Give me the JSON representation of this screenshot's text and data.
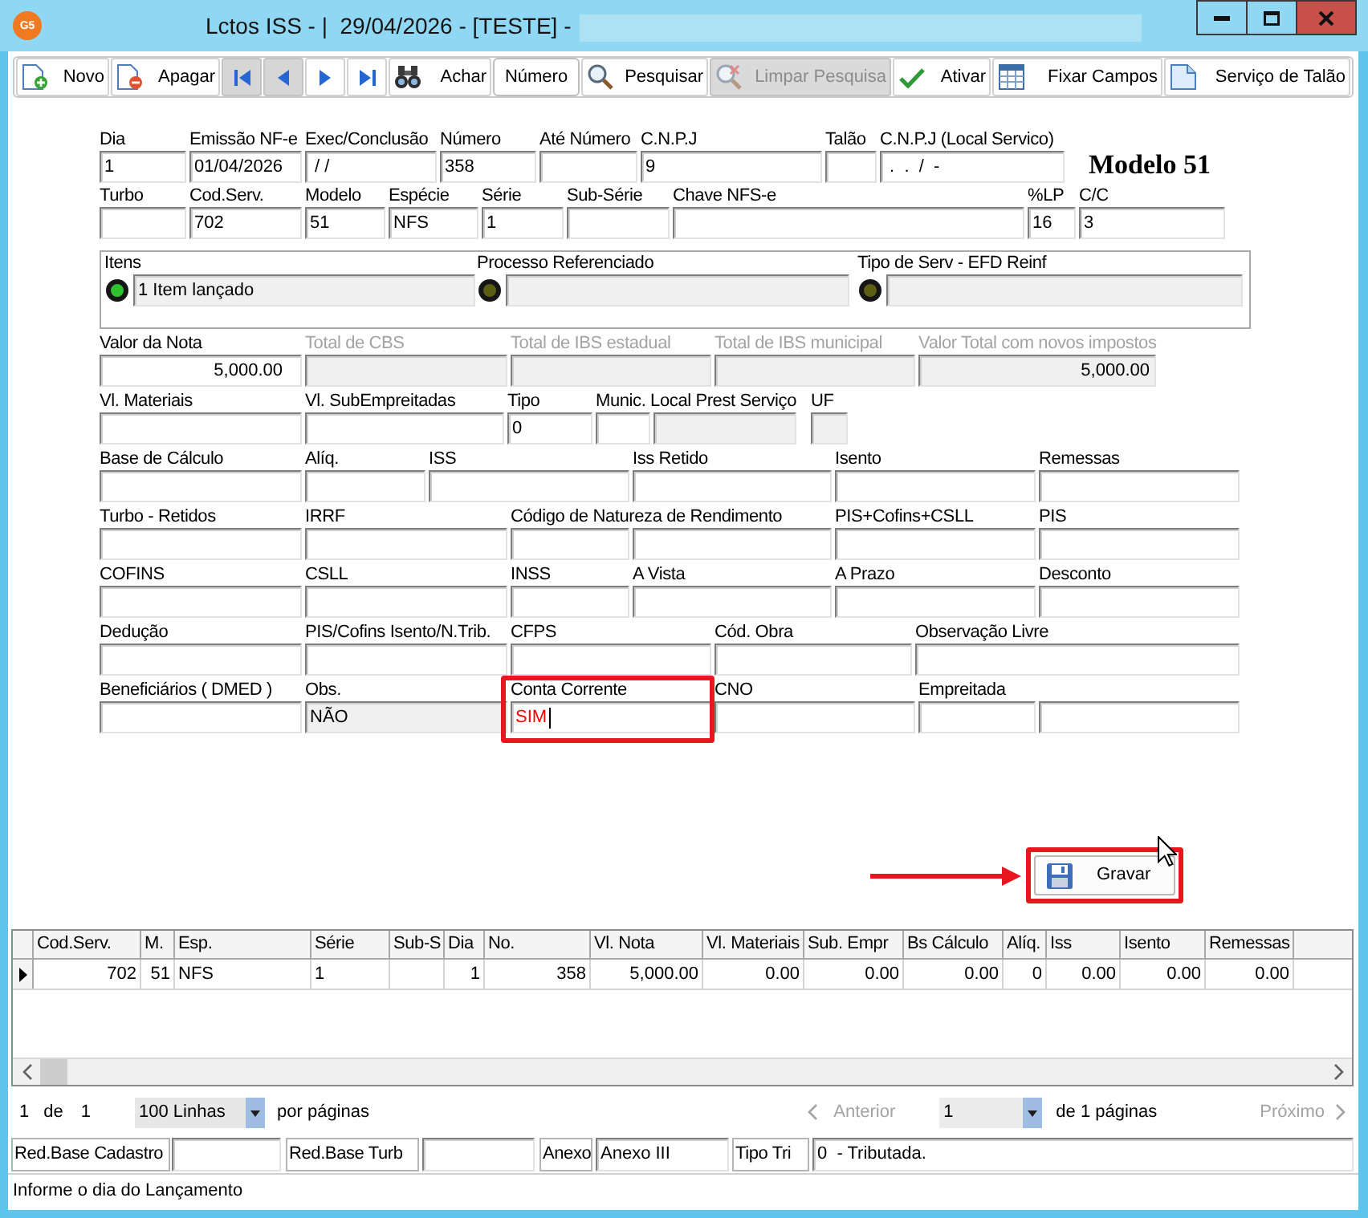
{
  "window": {
    "logo": "G5",
    "title": "Lctos ISS - |  29/04/2026 - [TESTE] -"
  },
  "toolbar": [
    {
      "kind": "button",
      "label": "Novo",
      "disabled": false
    },
    {
      "kind": "button",
      "label": "Apagar",
      "disabled": false
    },
    {
      "kind": "nav",
      "disabled": true
    },
    {
      "kind": "nav",
      "disabled": true
    },
    {
      "kind": "nav",
      "disabled": false
    },
    {
      "kind": "nav",
      "disabled": false
    },
    {
      "kind": "button",
      "label": "Achar",
      "disabled": false
    },
    {
      "kind": "field",
      "label": "Número",
      "disabled": false
    },
    {
      "kind": "button",
      "label": "Pesquisar",
      "disabled": false
    },
    {
      "kind": "button",
      "label": "Limpar Pesquisa",
      "disabled": true
    },
    {
      "kind": "button",
      "label": "Ativar",
      "disabled": false
    },
    {
      "kind": "button",
      "label": "Fixar Campos",
      "disabled": false
    },
    {
      "kind": "button",
      "label": "Serviço de Talão",
      "disabled": false
    }
  ],
  "form": {
    "header_rows": [
      [
        {
          "label": "Dia",
          "value": "1",
          "kind": "input",
          "highlighted": false
        },
        {
          "label": "Emissão NF-e",
          "value": "01/04/2026",
          "kind": "input",
          "highlighted": false
        },
        {
          "label": "Exec/Conclusão",
          "value": " / /",
          "kind": "input",
          "highlighted": false
        },
        {
          "label": "Número",
          "value": "358",
          "kind": "input",
          "highlighted": false
        },
        {
          "label": "Até Número",
          "kind": "input",
          "highlighted": false
        },
        {
          "label": "C.N.P.J",
          "value": "9",
          "kind": "input",
          "highlighted": false
        },
        {
          "label": "Talão",
          "kind": "input",
          "highlighted": false
        },
        {
          "label": "C.N.P.J (Local Servico)",
          "value": " .  .  /  -",
          "kind": "input",
          "highlighted": false
        }
      ],
      [
        {
          "label": "Turbo",
          "kind": "input",
          "highlighted": false
        },
        {
          "label": "Cod.Serv.",
          "value": "702",
          "kind": "input",
          "highlighted": false
        },
        {
          "label": "Modelo",
          "value": "51",
          "kind": "input",
          "highlighted": false
        },
        {
          "label": "Espécie",
          "value": "NFS",
          "kind": "input",
          "highlighted": false
        },
        {
          "label": "Série",
          "value": "1",
          "kind": "input",
          "highlighted": false
        },
        {
          "label": "Sub-Série",
          "kind": "input",
          "highlighted": false
        },
        {
          "label": "Chave NFS-e",
          "kind": "input",
          "highlighted": false
        },
        {
          "label": "%LP",
          "value": "16",
          "kind": "input",
          "highlighted": false
        },
        {
          "label": "C/C",
          "value": "3",
          "kind": "input",
          "highlighted": false
        }
      ]
    ],
    "model_title": "Modelo 51",
    "references": [
      {
        "label": "Itens",
        "value": "1 Item lançado",
        "color": "#2fc22f"
      },
      {
        "label": "Processo Referenciado",
        "color": "#5e5e12"
      },
      {
        "label": "Tipo de Serv - EFD Reinf",
        "color": "#5e5e12"
      }
    ],
    "rows": [
      [
        {
          "label": "Valor da Nota",
          "value": "5,000.00",
          "kind": "input",
          "highlighted": false
        },
        {
          "label": "Total de CBS",
          "kind": "disabled",
          "highlighted": false
        },
        {
          "label": "Total de IBS estadual",
          "kind": "disabled",
          "highlighted": false
        },
        {
          "label": "Total de IBS municipal",
          "kind": "disabled",
          "highlighted": false
        },
        {
          "label": "Valor Total com novos impostos",
          "value": "5,000.00",
          "kind": "disabled",
          "highlighted": false
        }
      ],
      [
        {
          "label": "Vl. Materiais",
          "kind": "input",
          "highlighted": false
        },
        {
          "label": "Vl. SubEmpreitadas",
          "kind": "input",
          "highlighted": false
        },
        {
          "label": "Tipo",
          "value": "0",
          "kind": "input",
          "highlighted": false
        },
        {
          "label": "Munic. Local Prest Serviço",
          "kind": "input",
          "highlighted": false
        },
        {
          "kind": "readonly",
          "highlighted": false
        },
        {
          "label": "UF",
          "kind": "readonly",
          "highlighted": false
        }
      ],
      [
        {
          "label": "Base de Cálculo",
          "kind": "input",
          "highlighted": false
        },
        {
          "label": "Alíq.",
          "kind": "input",
          "highlighted": false
        },
        {
          "label": "ISS",
          "kind": "input",
          "highlighted": false
        },
        {
          "label": "Iss Retido",
          "kind": "input",
          "highlighted": false
        },
        {
          "label": "Isento",
          "kind": "input",
          "highlighted": false
        },
        {
          "label": "Remessas",
          "kind": "input",
          "highlighted": false
        }
      ],
      [
        {
          "label": "Turbo - Retidos",
          "kind": "input",
          "highlighted": false
        },
        {
          "label": "IRRF",
          "kind": "input",
          "highlighted": false
        },
        {
          "label": "Código de Natureza de Rendimento",
          "kind": "input",
          "highlighted": false
        },
        {
          "kind": "input",
          "highlighted": false
        },
        {
          "label": "PIS+Cofins+CSLL",
          "kind": "input",
          "highlighted": false
        },
        {
          "label": "PIS",
          "kind": "input",
          "highlighted": false
        }
      ],
      [
        {
          "label": "COFINS",
          "kind": "input",
          "highlighted": false
        },
        {
          "label": "CSLL",
          "kind": "input",
          "highlighted": false
        },
        {
          "label": "INSS",
          "kind": "input",
          "highlighted": false
        },
        {
          "label": "A Vista",
          "kind": "input",
          "highlighted": false
        },
        {
          "label": "A Prazo",
          "kind": "input",
          "highlighted": false
        },
        {
          "label": "Desconto",
          "kind": "input",
          "highlighted": false
        }
      ],
      [
        {
          "label": "Dedução",
          "kind": "input",
          "highlighted": false
        },
        {
          "label": "PIS/Cofins Isento/N.Trib.",
          "kind": "input",
          "highlighted": false
        },
        {
          "label": "CFPS",
          "kind": "input",
          "highlighted": false
        },
        {
          "label": "Cód. Obra",
          "kind": "input",
          "highlighted": false
        },
        {
          "label": "Observação Livre",
          "kind": "input",
          "highlighted": false
        }
      ],
      [
        {
          "label": "Beneficiários ( DMED )",
          "kind": "input",
          "highlighted": false
        },
        {
          "label": "Obs.",
          "value": "NÃO",
          "kind": "readonly",
          "highlighted": false
        },
        {
          "label": "Conta Corrente",
          "value": "SIM",
          "kind": "focused",
          "highlighted": true
        },
        {
          "label": "CNO",
          "kind": "input",
          "highlighted": false
        },
        {
          "label": "Empreitada",
          "kind": "input",
          "highlighted": false
        },
        {
          "kind": "input",
          "highlighted": false
        }
      ]
    ]
  },
  "save_button": {
    "label": "Gravar",
    "highlighted": true
  },
  "grid": {
    "columns": [
      "Cod.Serv.",
      "M.",
      "Esp.",
      "Série",
      "Sub-S",
      "Dia",
      "No.",
      "Vl. Nota",
      "Vl. Materiais",
      "Sub. Empr",
      "Bs Cálculo",
      "Alíq.",
      "Iss",
      "Isento",
      "Remessas"
    ],
    "rows": [
      {
        "selected": true,
        "cells": [
          "702",
          "51",
          "NFS",
          "1",
          null,
          "1",
          "358",
          "5,000.00",
          "0.00",
          "0.00",
          "0.00",
          "0",
          "0.00",
          "0.00",
          "0.00"
        ]
      }
    ]
  },
  "pagination": {
    "record": "1",
    "record_of": "de",
    "record_total": "1",
    "page_size": "100 Linhas",
    "page_size_label": "por páginas",
    "previous": {
      "label": "Anterior",
      "disabled": true
    },
    "page": "1",
    "page_total": "de 1 páginas",
    "next": {
      "label": "Próximo",
      "disabled": true
    }
  },
  "info_bar": [
    {
      "kind": "label",
      "text": "Red.Base Cadastro"
    },
    {
      "kind": "field"
    },
    {
      "kind": "label",
      "text": "Red.Base Turb"
    },
    {
      "kind": "field"
    },
    {
      "kind": "label",
      "text": "Anexo"
    },
    {
      "kind": "field",
      "value": "Anexo III"
    },
    {
      "kind": "label",
      "text": "Tipo Tri"
    },
    {
      "kind": "field",
      "value": "0  - Tributada."
    }
  ],
  "status_bar": {
    "text": "Informe o dia do Lançamento"
  }
}
